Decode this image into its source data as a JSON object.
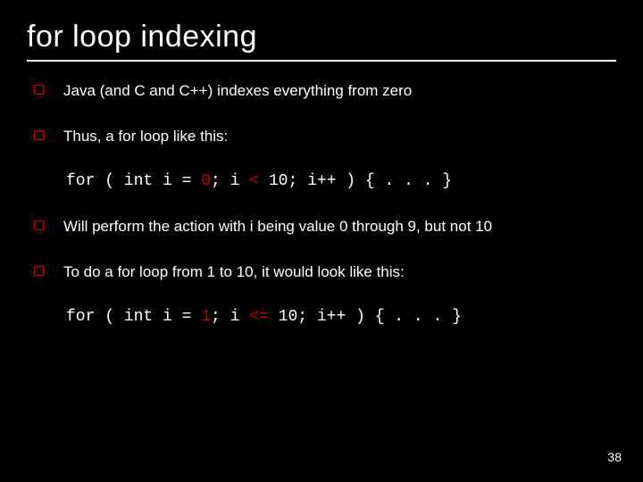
{
  "title": "for loop indexing",
  "bullets": {
    "b1": "Java (and C and C++) indexes everything from zero",
    "b2": "Thus, a for loop like this:",
    "b3": "Will perform the action with i being value 0 through 9, but not 10",
    "b4": "To do a for loop from 1 to 10, it would look like this:"
  },
  "code1": {
    "pre": "for ( int i = ",
    "hl1": "0",
    "mid": "; i ",
    "hl2": "<",
    "post": " 10; i++ ) { . . . }"
  },
  "code2": {
    "pre": "for ( int i = ",
    "hl1": "1",
    "mid": "; i ",
    "hl2": "<=",
    "post": " 10; i++ ) { . . . }"
  },
  "page_number": "38"
}
